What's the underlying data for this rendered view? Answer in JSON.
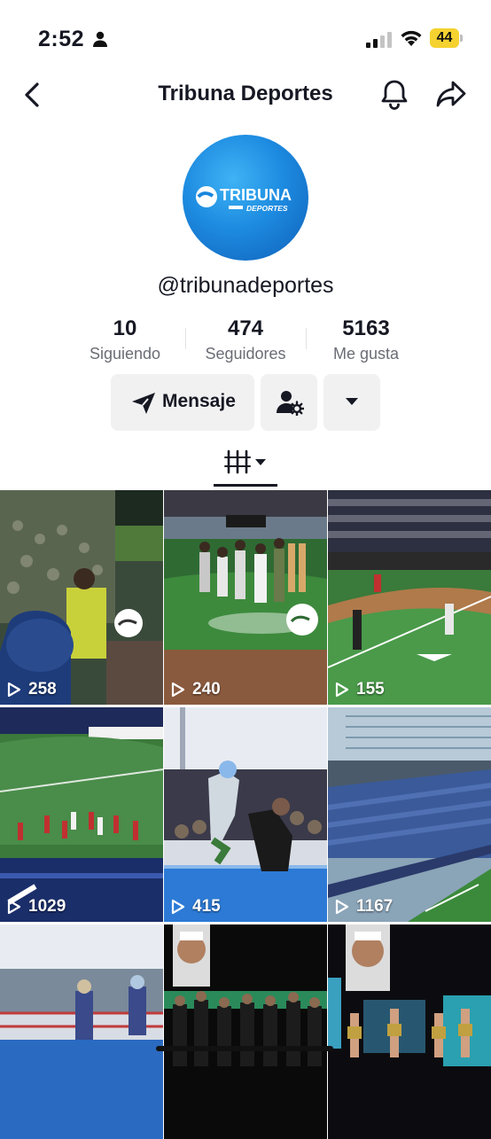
{
  "status_bar": {
    "time": "2:52",
    "battery": "44"
  },
  "header": {
    "title": "Tribuna Deportes"
  },
  "avatar": {
    "logo_line1": "TRIBUNA",
    "logo_line2": "DEPORTES"
  },
  "profile": {
    "username": "@tribunadeportes"
  },
  "stats": [
    {
      "value": "10",
      "label": "Siguiendo"
    },
    {
      "value": "474",
      "label": "Seguidores"
    },
    {
      "value": "5163",
      "label": "Me gusta"
    }
  ],
  "actions": {
    "message_label": "Mensaje"
  },
  "videos": [
    {
      "views": "258"
    },
    {
      "views": "240"
    },
    {
      "views": "155"
    },
    {
      "views": "1029"
    },
    {
      "views": "415"
    },
    {
      "views": "1167"
    },
    {
      "views": ""
    },
    {
      "views": ""
    },
    {
      "views": ""
    }
  ]
}
